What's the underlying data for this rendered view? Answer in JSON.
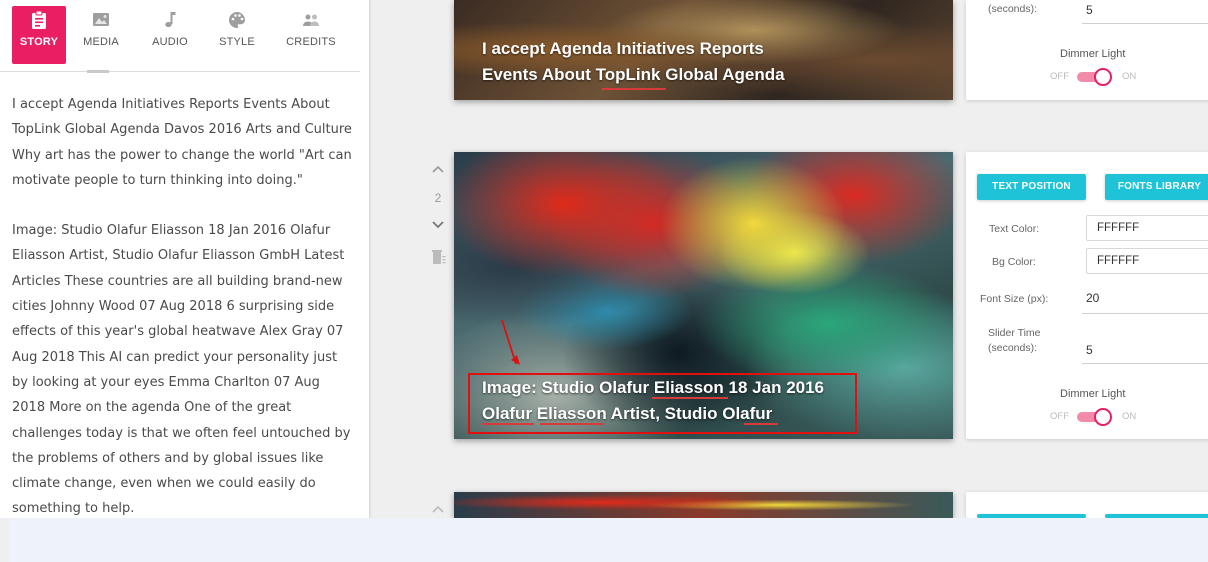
{
  "tabs": [
    {
      "id": "story",
      "label": "STORY",
      "icon": "clipboard-icon"
    },
    {
      "id": "media",
      "label": "MEDIA",
      "icon": "image-icon"
    },
    {
      "id": "audio",
      "label": "AUDIO",
      "icon": "music-note-icon"
    },
    {
      "id": "style",
      "label": "STYLE",
      "icon": "palette-icon"
    },
    {
      "id": "credits",
      "label": "CREDITS",
      "icon": "people-icon"
    }
  ],
  "active_tab": "STORY",
  "story": {
    "paragraph_1": "I accept Agenda Initiatives Reports Events About TopLink Global Agenda Davos 2016 Arts and Culture Why art has the power to change the world \"Art can motivate people to turn thinking into doing.\"",
    "paragraph_2": "Image: Studio Olafur Eliasson 18 Jan 2016 Olafur Eliasson Artist, Studio Olafur Eliasson GmbH Latest Articles These countries are all building brand-new cities Johnny Wood 07 Aug 2018 6 surprising side effects of this year's global heatwave Alex Gray 07 Aug 2018 This AI can predict your personality just by looking at your eyes Emma Charlton 07 Aug 2018 More on the agenda One of the great challenges today is that we often feel untouched by the problems of others and by global issues like climate change, even when we could easily do something to help."
  },
  "slides": [
    {
      "caption_line1": "I accept  Agenda Initiatives  Reports",
      "caption_line2": "Events  About TopLink  Global Agenda"
    },
    {
      "number": "2",
      "caption_line1": "Image: Studio Olafur Eliasson  18 Jan 2016",
      "caption_line2": "Olafur Eliasson Artist, Studio Olafur"
    }
  ],
  "settings": {
    "slider_time_label_partial": "(seconds):",
    "slider_time_value_1": "5",
    "dimmer_light_label": "Dimmer Light",
    "toggle_off": "OFF",
    "toggle_on": "ON",
    "text_position_btn": "TEXT POSITION",
    "fonts_library_btn": "FONTS LIBRARY",
    "text_color_label": "Text Color:",
    "text_color_value": "FFFFFF",
    "bg_color_label": "Bg Color:",
    "bg_color_value": "FFFFFF",
    "font_size_label": "Font Size (px):",
    "font_size_value": "20",
    "slider_time_label_line1": "Slider Time",
    "slider_time_label_line2": "(seconds):",
    "slider_time_value_2": "5"
  },
  "colors": {
    "accent_pink": "#e91e63",
    "cyan_button": "#1ec3d8",
    "highlight_red": "#e01010"
  }
}
